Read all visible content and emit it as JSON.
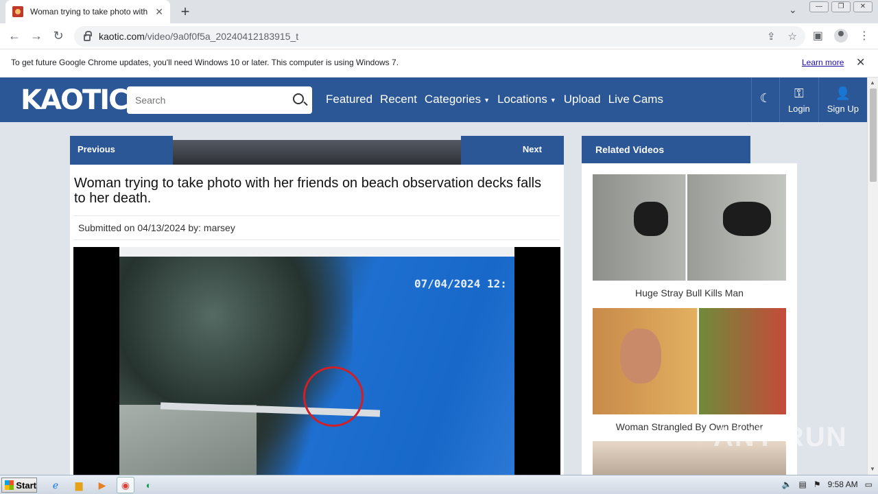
{
  "browser": {
    "tab_title": "Woman trying to take photo with her friends on beach observation decks falls to her death",
    "url_host": "kaotic.com",
    "url_path": "/video/9a0f0f5a_20240412183915_t",
    "infobar_message": "To get future Google Chrome updates, you'll need Windows 10 or later. This computer is using Windows 7.",
    "infobar_link": "Learn more"
  },
  "site": {
    "logo": "KAOTIC",
    "search_placeholder": "Search",
    "nav": [
      "Featured",
      "Recent",
      "Categories",
      "Locations",
      "Upload",
      "Live Cams"
    ],
    "login": "Login",
    "signup": "Sign Up"
  },
  "article": {
    "prev": "Previous",
    "next": "Next",
    "title": "Woman trying to take photo with her friends on beach observation decks falls to her death.",
    "submitted": "Submitted on 04/13/2024 by:",
    "author": "marsey",
    "video_timestamp": "07/04/2024 12:"
  },
  "sidebar": {
    "heading": "Related Videos",
    "items": [
      {
        "title": "Huge Stray Bull Kills Man"
      },
      {
        "title": "Woman Strangled By Own Brother"
      }
    ]
  },
  "watermark": "ANY RUN",
  "taskbar": {
    "start": "Start",
    "time": "9:58 AM"
  },
  "colors": {
    "header_blue": "#2b5797",
    "video_circle": "#d21f26"
  }
}
